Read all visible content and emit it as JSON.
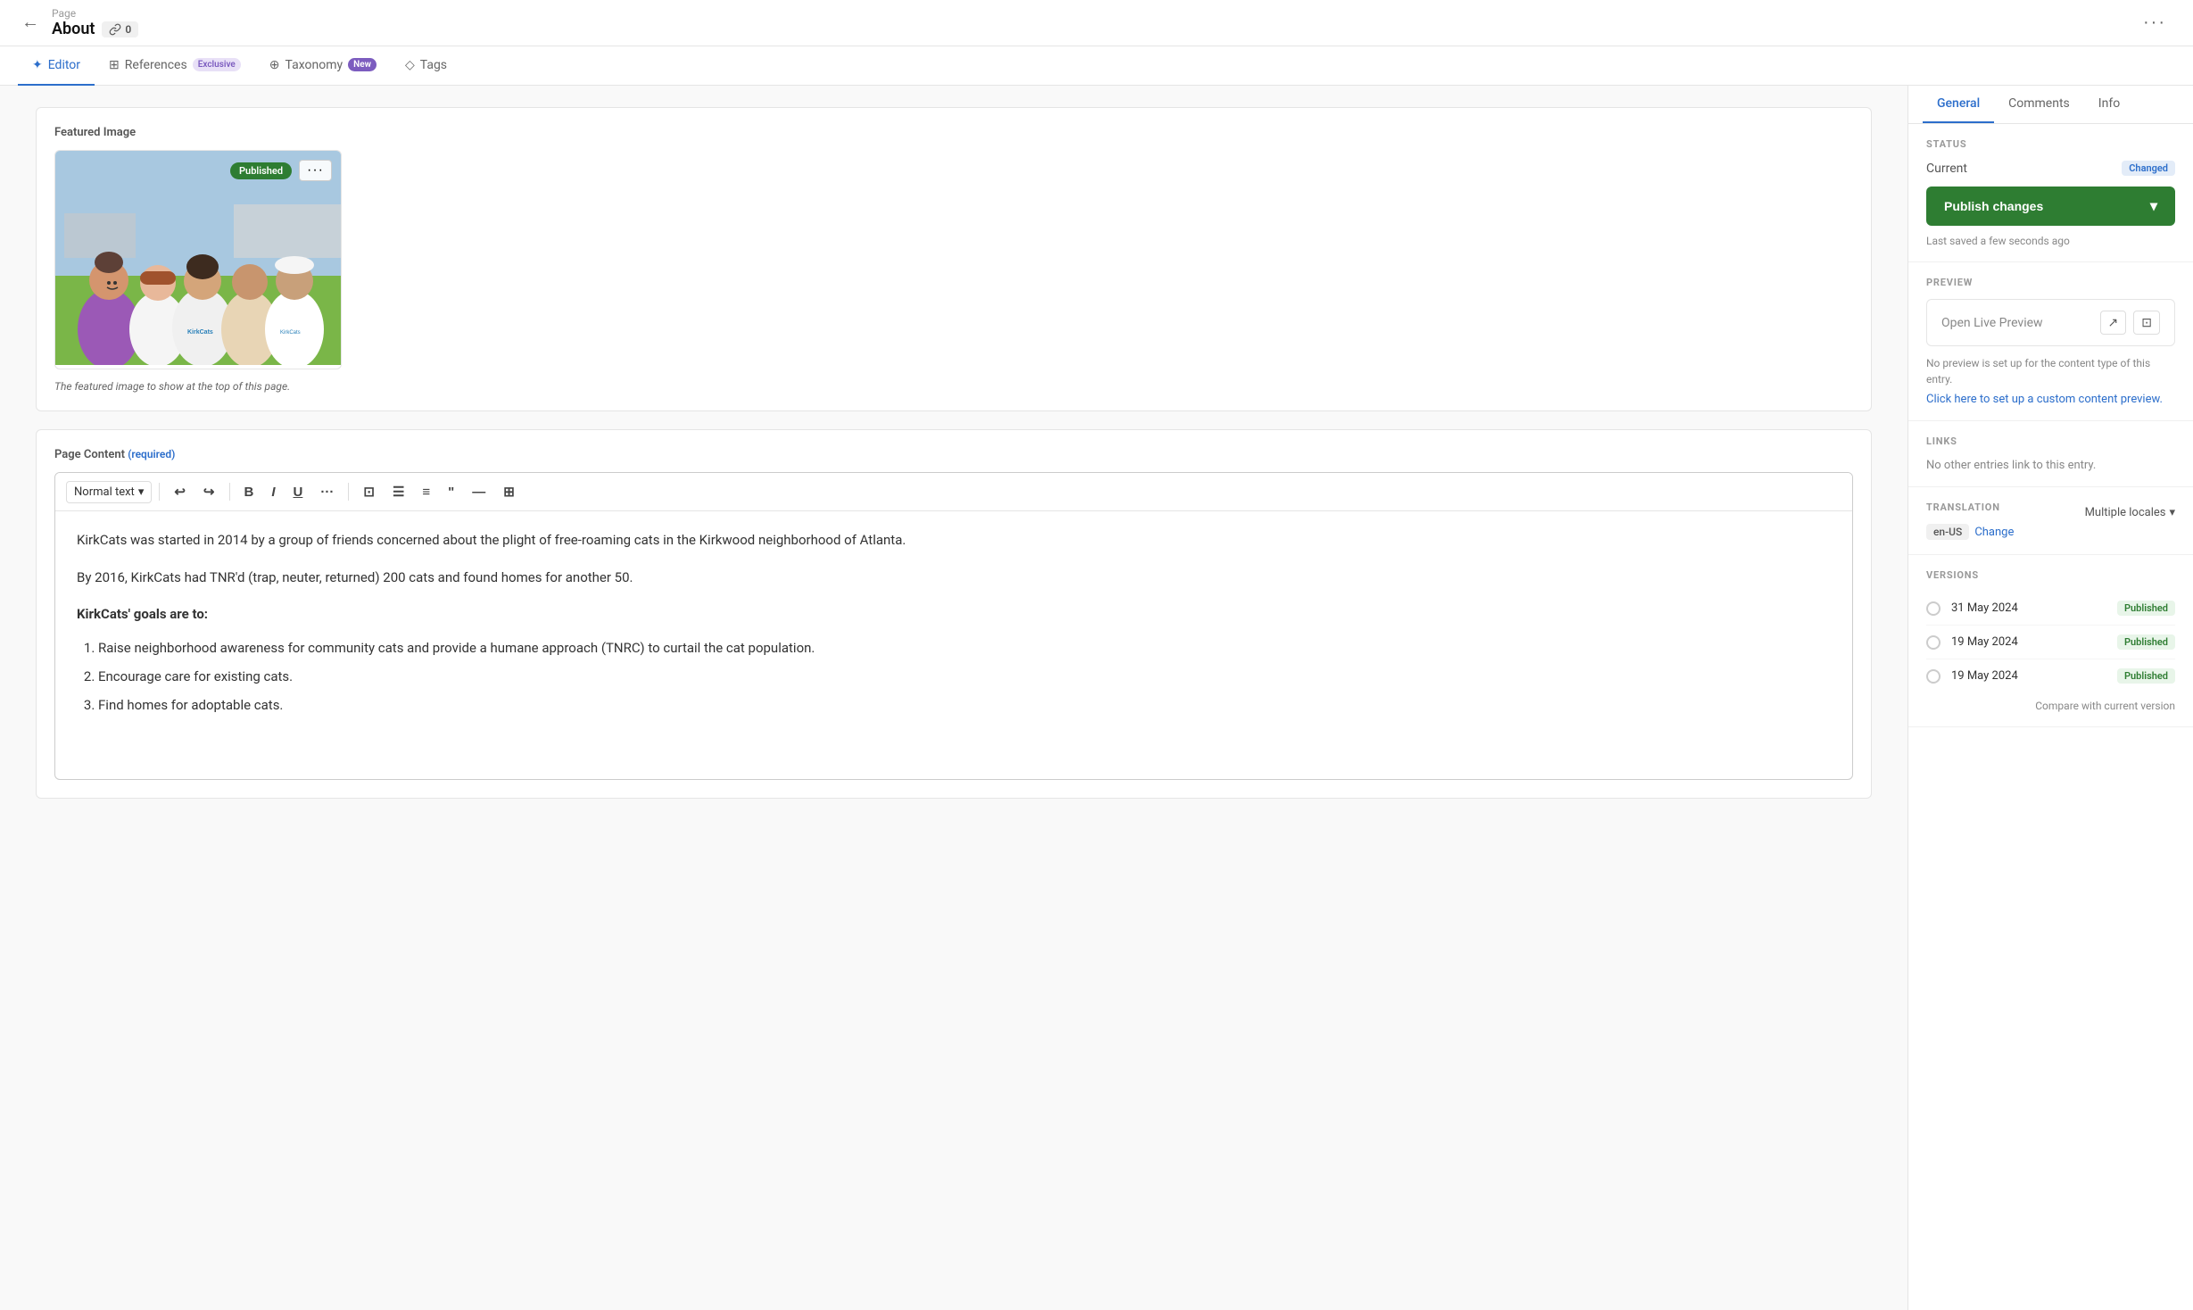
{
  "topBar": {
    "breadcrumb": "Page",
    "title": "About",
    "linkCount": "0",
    "moreLabel": "···"
  },
  "tabs": [
    {
      "id": "editor",
      "label": "Editor",
      "icon": "✦",
      "active": true
    },
    {
      "id": "references",
      "label": "References",
      "badge": "Exclusive",
      "badgeType": "exclusive"
    },
    {
      "id": "taxonomy",
      "label": "Taxonomy",
      "badge": "New",
      "badgeType": "new"
    },
    {
      "id": "tags",
      "label": "Tags"
    }
  ],
  "sidebarTabs": [
    {
      "id": "general",
      "label": "General",
      "active": true
    },
    {
      "id": "comments",
      "label": "Comments"
    },
    {
      "id": "info",
      "label": "Info"
    }
  ],
  "featuredImage": {
    "label": "Featured Image",
    "status": "Published",
    "caption": "The featured image to show at the top of this page."
  },
  "pageContent": {
    "label": "Page Content",
    "required": "(required)",
    "toolbar": {
      "textStyle": "Normal text",
      "buttons": [
        "undo",
        "redo",
        "bold",
        "italic",
        "underline",
        "more",
        "link",
        "bullet-list",
        "ordered-list",
        "blockquote",
        "hr",
        "table"
      ]
    },
    "paragraphs": [
      "KirkCats was started in 2014 by a group of friends concerned about the plight of free-roaming cats in the Kirkwood neighborhood of Atlanta.",
      "By 2016, KirkCats had TNR'd (trap, neuter, returned) 200 cats and found homes for another 50."
    ],
    "heading": "KirkCats' goals are to:",
    "listItems": [
      "Raise neighborhood awareness for community cats and provide a humane approach (TNRC) to curtail the cat population.",
      "Encourage care for existing cats.",
      "Find homes for adoptable cats."
    ]
  },
  "sidebar": {
    "status": {
      "title": "STATUS",
      "currentLabel": "Current",
      "changedBadge": "Changed",
      "publishBtn": "Publish changes",
      "lastSaved": "Last saved a few seconds ago"
    },
    "preview": {
      "title": "PREVIEW",
      "label": "Open Live Preview",
      "note": "No preview is set up for the content type of this entry.",
      "setupLink": "Click here to set up a custom content preview."
    },
    "links": {
      "title": "LINKS",
      "note": "No other entries link to this entry."
    },
    "translation": {
      "title": "TRANSLATION",
      "localesLabel": "Multiple locales",
      "locale": "en-US",
      "changeLabel": "Change"
    },
    "versions": {
      "title": "VERSIONS",
      "items": [
        {
          "date": "31 May 2024",
          "status": "Published"
        },
        {
          "date": "19 May 2024",
          "status": "Published"
        },
        {
          "date": "19 May 2024",
          "status": "Published"
        }
      ],
      "compareLink": "Compare with current version"
    }
  }
}
